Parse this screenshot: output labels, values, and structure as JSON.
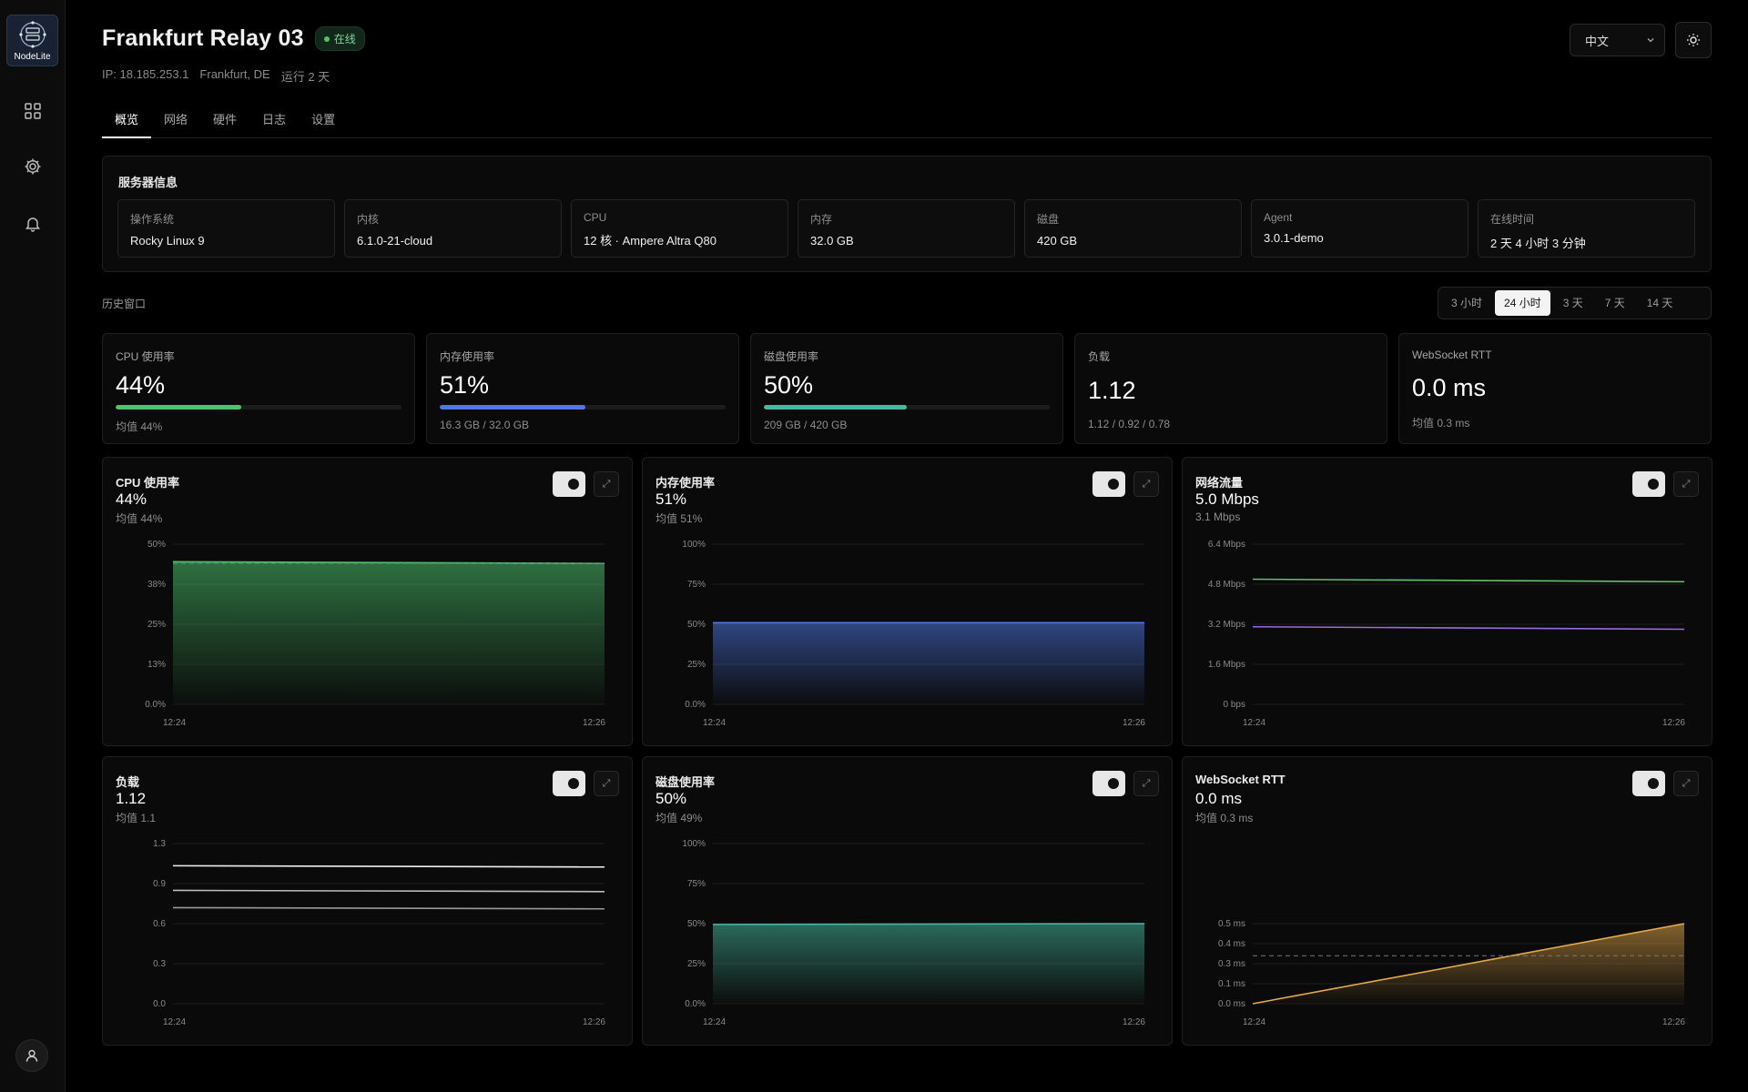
{
  "sidebar": {
    "logo_text": "NodeLite",
    "items": [
      {
        "icon": "grid-icon"
      },
      {
        "icon": "gear-icon"
      },
      {
        "icon": "bell-icon"
      }
    ],
    "user_icon": "user-icon"
  },
  "header": {
    "title": "Frankfurt Relay 03",
    "status": "在线",
    "status_color": "#4cc46e",
    "ip": "IP: 18.185.253.1",
    "location": "Frankfurt, DE",
    "uptime": "运行 2 天",
    "language": "中文"
  },
  "tabs": [
    {
      "label": "概览",
      "active": true
    },
    {
      "label": "网络"
    },
    {
      "label": "硬件"
    },
    {
      "label": "日志"
    },
    {
      "label": "设置"
    }
  ],
  "server_info": {
    "title": "服务器信息",
    "items": [
      {
        "label": "操作系统",
        "value": "Rocky Linux 9"
      },
      {
        "label": "内核",
        "value": "6.1.0-21-cloud"
      },
      {
        "label": "CPU",
        "value": "12 核 · Ampere Altra Q80"
      },
      {
        "label": "内存",
        "value": "32.0 GB"
      },
      {
        "label": "磁盘",
        "value": "420 GB"
      },
      {
        "label": "Agent",
        "value": "3.0.1-demo"
      },
      {
        "label": "在线时间",
        "value": "2 天 4 小时 3 分钟"
      }
    ]
  },
  "history": {
    "label": "历史窗口",
    "ranges": [
      "3 小时",
      "24 小时",
      "3 天",
      "7 天",
      "14 天"
    ],
    "active": "24 小时"
  },
  "stats": [
    {
      "label": "CPU 使用率",
      "value": "44%",
      "progress": 0.44,
      "color": "#4cc46e",
      "sub": "均值 44%"
    },
    {
      "label": "内存使用率",
      "value": "51%",
      "progress": 0.51,
      "color": "#4f78e6",
      "sub": "16.3 GB / 32.0 GB"
    },
    {
      "label": "磁盘使用率",
      "value": "50%",
      "progress": 0.5,
      "color": "#46b8a0",
      "sub": "209 GB / 420 GB"
    },
    {
      "label": "负载",
      "value": "1.12",
      "sub": "1.12 / 0.92 / 0.78"
    },
    {
      "label": "WebSocket RTT",
      "value": "0.0 ms",
      "sub": "均值 0.3 ms"
    }
  ],
  "charts": [
    {
      "title": "CPU 使用率",
      "value": "44%",
      "sub": "均值 44%"
    },
    {
      "title": "内存使用率",
      "value": "51%",
      "sub": "均值 51%"
    },
    {
      "title": "网络流量",
      "value": "5.0 Mbps",
      "sub": "3.1 Mbps"
    },
    {
      "title": "负载",
      "value": "1.12",
      "sub": "均值 1.1"
    },
    {
      "title": "磁盘使用率",
      "value": "50%",
      "sub": "均值 49%"
    },
    {
      "title": "WebSocket RTT",
      "value": "0.0 ms",
      "sub": "均值 0.3 ms"
    }
  ],
  "chart_data": [
    {
      "type": "area",
      "title": "CPU 使用率",
      "x": [
        "12:24",
        "12:26"
      ],
      "yticks": [
        "50%",
        "38%",
        "25%",
        "13%",
        "0.0%"
      ],
      "ylim": [
        0,
        50
      ],
      "series": [
        {
          "values": [
            44.5,
            44.0
          ],
          "color": "#4cc46e"
        }
      ],
      "mean": 44,
      "mean_dashed": true
    },
    {
      "type": "area",
      "title": "内存使用率",
      "x": [
        "12:24",
        "12:26"
      ],
      "yticks": [
        "100%",
        "75%",
        "50%",
        "25%",
        "0.0%"
      ],
      "ylim": [
        0,
        100
      ],
      "series": [
        {
          "values": [
            51,
            51
          ],
          "color": "#4f78e6"
        }
      ]
    },
    {
      "type": "line",
      "title": "网络流量",
      "x": [
        "12:24",
        "12:26"
      ],
      "yticks": [
        "6.4 Mbps",
        "4.8 Mbps",
        "3.2 Mbps",
        "1.6 Mbps",
        "0 bps"
      ],
      "ylim": [
        0,
        6.4
      ],
      "series": [
        {
          "values": [
            5.0,
            4.9
          ],
          "color": "#5fc46a"
        },
        {
          "values": [
            3.1,
            3.0
          ],
          "color": "#9b6ae0"
        }
      ]
    },
    {
      "type": "line",
      "title": "负载",
      "x": [
        "12:24",
        "12:26"
      ],
      "yticks": [
        "1.3",
        "0.9",
        "0.6",
        "0.3",
        "0.0"
      ],
      "ylim": [
        0,
        1.3
      ],
      "series": [
        {
          "values": [
            1.12,
            1.11
          ],
          "color": "#f0f0f0"
        },
        {
          "values": [
            0.92,
            0.91
          ],
          "color": "#bdbdbd"
        },
        {
          "values": [
            0.78,
            0.77
          ],
          "color": "#9a9a9a"
        }
      ]
    },
    {
      "type": "area",
      "title": "磁盘使用率",
      "x": [
        "12:24",
        "12:26"
      ],
      "yticks": [
        "100%",
        "75%",
        "50%",
        "25%",
        "0.0%"
      ],
      "ylim": [
        0,
        100
      ],
      "series": [
        {
          "values": [
            49.5,
            50
          ],
          "color": "#46b8a0"
        }
      ]
    },
    {
      "type": "area",
      "title": "WebSocket RTT",
      "x": [
        "12:24",
        "12:26"
      ],
      "yticks": [
        "0.5 ms",
        "0.4 ms",
        "0.3 ms",
        "0.1 ms",
        "0.0 ms"
      ],
      "ylim": [
        0,
        0.5
      ],
      "series": [
        {
          "values": [
            0.0,
            0.5
          ],
          "color": "#e6a94a"
        }
      ],
      "mean": 0.3,
      "mean_dashed": true
    }
  ]
}
